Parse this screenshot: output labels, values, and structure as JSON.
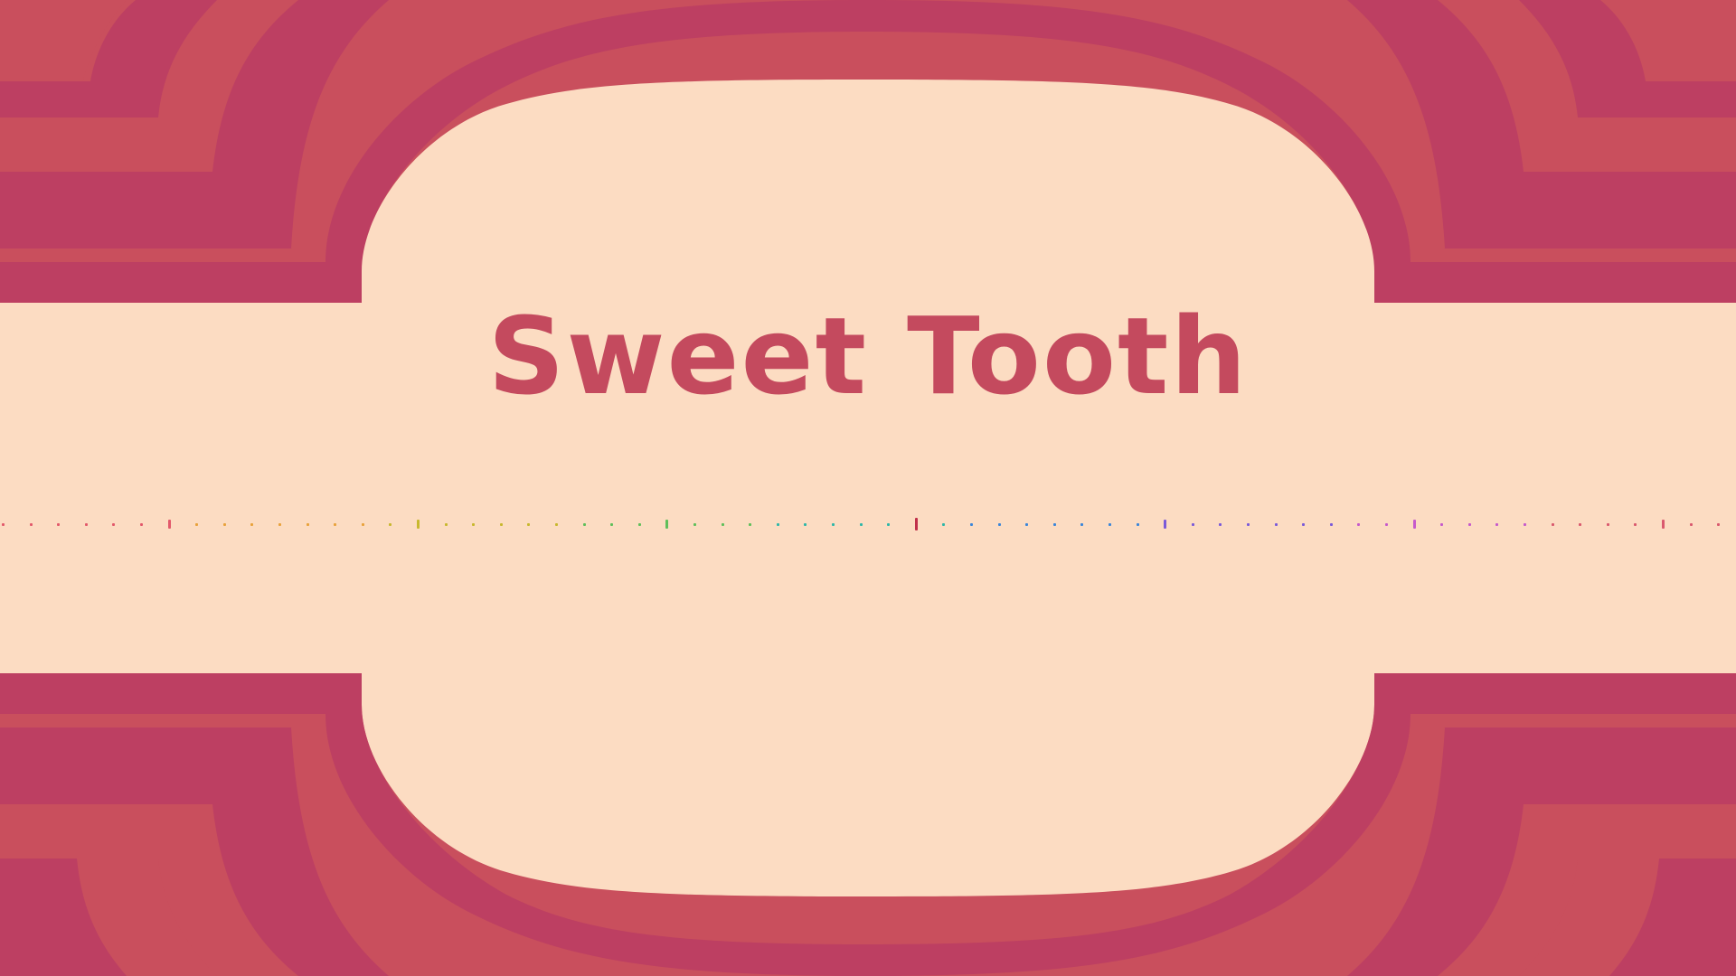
{
  "screen": "title-screen",
  "title": "Sweet Tooth",
  "colors": {
    "background": "#fcdcc2",
    "stripe_light": "#c94f5d",
    "stripe_dark": "#bd3f62",
    "title_text": "#c44a5e"
  },
  "loading_indicator": {
    "progress": 0.525,
    "dot_palette": [
      "#e2596b",
      "#e8a23c",
      "#c8b82e",
      "#5fbf5a",
      "#2eb7a8",
      "#3b86d9",
      "#7a5ad9",
      "#c65acb",
      "#d9596e"
    ]
  }
}
